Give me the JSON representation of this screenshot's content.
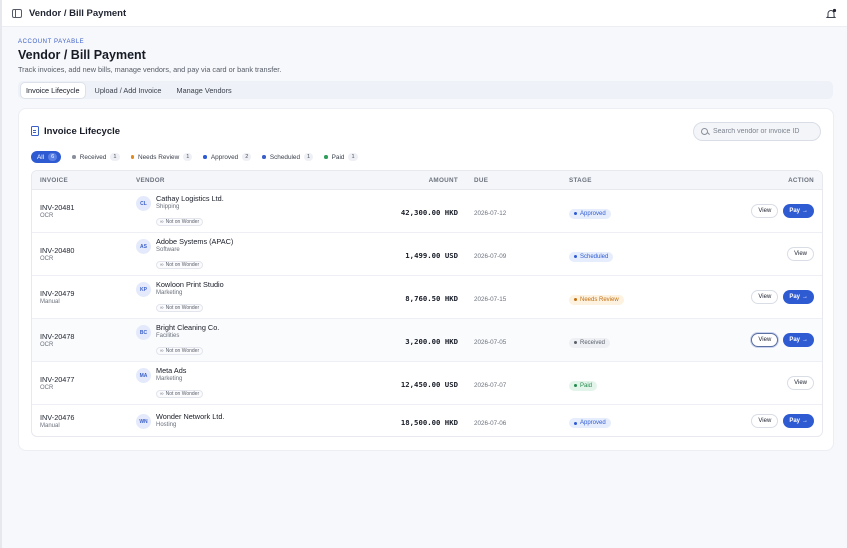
{
  "topbar": {
    "title": "Vendor / Bill Payment"
  },
  "header": {
    "eyebrow": "ACCOUNT PAYABLE",
    "title": "Vendor / Bill Payment",
    "subtitle": "Track invoices, add new bills, manage vendors, and pay via card or bank transfer."
  },
  "tabs": [
    {
      "label": "Invoice Lifecycle",
      "active": true
    },
    {
      "label": "Upload / Add Invoice",
      "active": false
    },
    {
      "label": "Manage Vendors",
      "active": false
    }
  ],
  "card": {
    "title": "Invoice Lifecycle",
    "search_placeholder": "Search vendor or invoice ID"
  },
  "filters": [
    {
      "label": "All",
      "count": "6",
      "color": ""
    },
    {
      "label": "Received",
      "count": "1",
      "color": "#8a909b"
    },
    {
      "label": "Needs Review",
      "count": "1",
      "color": "#e08a1e"
    },
    {
      "label": "Approved",
      "count": "2",
      "color": "#2f5bd2"
    },
    {
      "label": "Scheduled",
      "count": "1",
      "color": "#3b5fc8"
    },
    {
      "label": "Paid",
      "count": "1",
      "color": "#2e9e5b"
    }
  ],
  "table": {
    "headers": [
      "INVOICE",
      "VENDOR",
      "AMOUNT",
      "DUE",
      "STAGE",
      "ACTION"
    ],
    "not_on_wonder": "Not on Wonder",
    "view_label": "View",
    "pay_label": "Pay",
    "rows": [
      {
        "id": "INV-20481",
        "source": "OCR",
        "initials": "CL",
        "vendor": "Cathay Logistics Ltd.",
        "category": "Shipping",
        "wonder": true,
        "amount": "42,300.00 HKD",
        "due": "2026-07-12",
        "stage": "Approved",
        "pay": true
      },
      {
        "id": "INV-20480",
        "source": "OCR",
        "initials": "AS",
        "vendor": "Adobe Systems (APAC)",
        "category": "Software",
        "wonder": true,
        "amount": "1,499.00 USD",
        "due": "2026-07-09",
        "stage": "Scheduled",
        "pay": false
      },
      {
        "id": "INV-20479",
        "source": "Manual",
        "initials": "KP",
        "vendor": "Kowloon Print Studio",
        "category": "Marketing",
        "wonder": true,
        "amount": "8,760.50 HKD",
        "due": "2026-07-15",
        "stage": "Needs Review",
        "pay": true
      },
      {
        "id": "INV-20478",
        "source": "OCR",
        "initials": "BC",
        "vendor": "Bright Cleaning Co.",
        "category": "Facilities",
        "wonder": true,
        "amount": "3,200.00 HKD",
        "due": "2026-07-05",
        "stage": "Received",
        "pay": true
      },
      {
        "id": "INV-20477",
        "source": "OCR",
        "initials": "MA",
        "vendor": "Meta Ads",
        "category": "Marketing",
        "wonder": true,
        "amount": "12,450.00 USD",
        "due": "2026-07-07",
        "stage": "Paid",
        "pay": false
      },
      {
        "id": "INV-20476",
        "source": "Manual",
        "initials": "WN",
        "vendor": "Wonder Network Ltd.",
        "category": "Hosting",
        "wonder": false,
        "amount": "18,500.00 HKD",
        "due": "2026-07-06",
        "stage": "Approved",
        "pay": true
      }
    ]
  },
  "stage_colors": {
    "Approved": {
      "bg": "#e6edfc",
      "fg": "#2f5bd2"
    },
    "Scheduled": {
      "bg": "#e6edfc",
      "fg": "#2f5bd2"
    },
    "Needs Review": {
      "bg": "#fdf1e0",
      "fg": "#c2700f"
    },
    "Received": {
      "bg": "#eef0f4",
      "fg": "#5a606b"
    },
    "Paid": {
      "bg": "#e3f5ea",
      "fg": "#23894c"
    }
  }
}
